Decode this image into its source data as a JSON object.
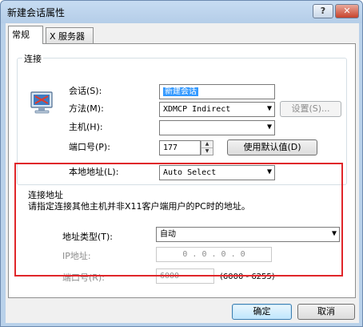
{
  "window": {
    "title": "新建会话属性",
    "help_label": "?",
    "close_label": "✕"
  },
  "tabs": {
    "general": "常规",
    "x_server": "X 服务器"
  },
  "connect_group": {
    "legend": "连接",
    "session_label": "会话(S):",
    "session_value": "新建会话",
    "method_label": "方法(M):",
    "method_value": "XDMCP Indirect",
    "settings_button": "设置(S)...",
    "host_label": "主机(H):",
    "host_value": "",
    "port_label": "端口号(P):",
    "port_value": "177",
    "use_default_button": "使用默认值(D)",
    "local_address_label": "本地地址(L):",
    "local_address_value": "Auto Select"
  },
  "connect_address_group": {
    "legend": "连接地址",
    "description": "请指定连接其他主机并非X11客户端用户的PC时的地址。",
    "address_type_label": "地址类型(T):",
    "address_type_value": "自动",
    "ip_label": "IP地址:",
    "ip_value": "0 . 0 . 0 . 0",
    "port_label": "端口号(R):",
    "port_value": "6000",
    "port_range": "(6000 - 6255)"
  },
  "footer": {
    "ok_button": "确定",
    "cancel_button": "取消"
  },
  "icons": {
    "computer": "computer-monitor-icon",
    "dropdown": "chevron-down-icon"
  },
  "colors": {
    "highlight": "#e0262a",
    "selection": "#3399ff"
  }
}
